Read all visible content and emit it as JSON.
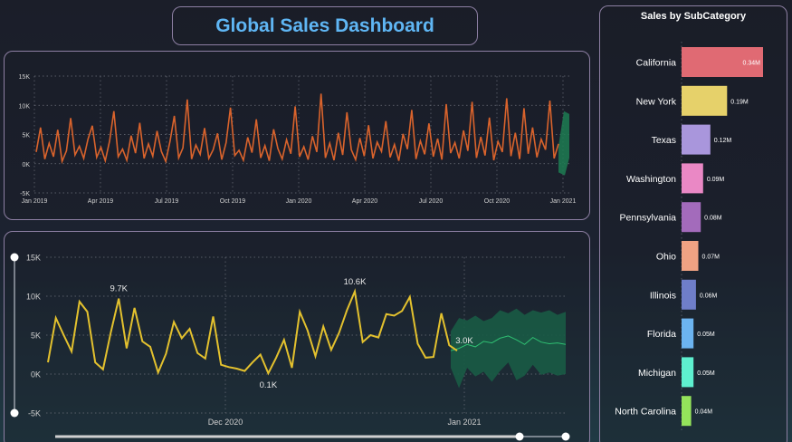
{
  "title": "Global Sales Dashboard",
  "top_chart": {
    "y_ticks": [
      "15K",
      "10K",
      "5K",
      "0K",
      "-5K"
    ],
    "x_ticks": [
      "Jan 2019",
      "Apr 2019",
      "Jul 2019",
      "Oct 2019",
      "Jan 2020",
      "Apr 2020",
      "Jul 2020",
      "Oct 2020",
      "Jan 2021"
    ],
    "colors": {
      "line": "#d9632c",
      "forecast": "#1d7d52"
    }
  },
  "bottom_chart": {
    "y_ticks": [
      "15K",
      "10K",
      "5K",
      "0K",
      "-5K"
    ],
    "x_ticks": [
      "Dec 2020",
      "Jan 2021"
    ],
    "annotations": [
      "9.7K",
      "10.6K",
      "0.1K",
      "3.0K"
    ],
    "colors": {
      "line": "#e3c12e",
      "forecast": "#1a5b45",
      "forecast_line": "#2fbf72"
    }
  },
  "bar_chart": {
    "title": "Sales by SubCategory",
    "categories": [
      "California",
      "New York",
      "Texas",
      "Washington",
      "Pennsylvania",
      "Ohio",
      "Illinois",
      "Florida",
      "Michigan",
      "North Carolina"
    ],
    "values": [
      0.34,
      0.19,
      0.12,
      0.09,
      0.08,
      0.07,
      0.06,
      0.05,
      0.05,
      0.04
    ],
    "labels": [
      "0.34M",
      "0.19M",
      "0.12M",
      "0.09M",
      "0.08M",
      "0.07M",
      "0.06M",
      "0.05M",
      "0.05M",
      "0.04M"
    ],
    "colors": [
      "#e06a73",
      "#e6d16a",
      "#a996dc",
      "#ea88c5",
      "#a36bbb",
      "#f0a283",
      "#6f7ec9",
      "#6cb4f0",
      "#5ef0cf",
      "#94e35b"
    ]
  },
  "chart_data": [
    {
      "type": "line",
      "title": "",
      "xlabel": "",
      "ylabel": "",
      "ylim": [
        -5000,
        15000
      ],
      "x_range": [
        "2019-01-01",
        "2021-01-15"
      ],
      "grid": true,
      "series": [
        {
          "values": [
            2000,
            6200,
            800,
            3500,
            1200,
            5800,
            400,
            2200,
            7800,
            1500,
            3000,
            900,
            4200,
            6500,
            1100,
            2800,
            500,
            3900,
            9000,
            1200,
            2500,
            600,
            4800,
            1800,
            7000,
            900,
            3400,
            1300,
            5600,
            2100,
            400,
            3800,
            8200,
            1000,
            2700,
            11000,
            800,
            3200,
            1600,
            6100,
            900,
            2400,
            5200,
            700,
            3600,
            9600,
            1400,
            2300,
            600,
            4500,
            1900,
            7600,
            1000,
            3100,
            500,
            5900,
            2600,
            800,
            4100,
            1700,
            9800,
            1200,
            2900,
            700,
            4700,
            2000,
            12000,
            1000,
            3500,
            600,
            5300,
            1500,
            8800,
            2400,
            700,
            4400,
            1300,
            6600,
            900,
            3700,
            2100,
            7300,
            1100,
            3300,
            500,
            5100,
            2500,
            9200,
            800,
            3900,
            1600,
            6900,
            1200,
            4300,
            700,
            10200,
            1800,
            3600,
            900,
            5700,
            2200,
            10600,
            1000,
            4600,
            1400,
            7900,
            600,
            3800,
            2000,
            11200,
            1300,
            5300,
            800,
            9500,
            1700,
            6200,
            1100,
            4200,
            2400,
            10800,
            900,
            3400
          ]
        }
      ],
      "forecast": {
        "x_range": [
          "2020-12-25",
          "2021-01-15"
        ],
        "lower": -2000,
        "upper": 9000
      }
    },
    {
      "type": "line",
      "title": "",
      "xlabel": "",
      "ylabel": "",
      "ylim": [
        -5000,
        15000
      ],
      "grid": true,
      "series": [
        {
          "values": [
            1500,
            7200,
            5000,
            2900,
            9300,
            8000,
            1500,
            600,
            5400,
            9700,
            3300,
            8500,
            4200,
            3500,
            200,
            2600,
            6700,
            4600,
            5800,
            2700,
            2000,
            7400,
            1200,
            900,
            700,
            400,
            1500,
            2500,
            100,
            2100,
            4400,
            800,
            8000,
            5600,
            2300,
            6100,
            3100,
            5300,
            8200,
            10600,
            4100,
            5000,
            4700,
            7700,
            7500,
            8100,
            9900,
            3900,
            2100,
            2200,
            7800,
            3700,
            3000
          ]
        }
      ],
      "forecast": {
        "lower": [
          800,
          -1800,
          800,
          -300,
          300,
          -1000,
          400,
          1500,
          -800,
          -200,
          1200,
          -100,
          200,
          -200,
          0
        ],
        "center": [
          3000,
          3300,
          3800,
          3500,
          4200,
          4000,
          4600,
          4900,
          4400,
          3800,
          4700,
          4100,
          3900,
          4000,
          3800
        ],
        "upper": [
          5500,
          7200,
          6900,
          7500,
          6800,
          7200,
          8200,
          7800,
          8400,
          7600,
          8200,
          7900,
          8200,
          7600,
          8000
        ]
      },
      "x_ticks": [
        "Dec 2020",
        "Jan 2021"
      ],
      "annotations": [
        {
          "label": "9.7K"
        },
        {
          "label": "10.6K"
        },
        {
          "label": "0.1K"
        },
        {
          "label": "3.0K"
        }
      ]
    },
    {
      "type": "bar",
      "title": "Sales by SubCategory",
      "categories": [
        "California",
        "New York",
        "Texas",
        "Washington",
        "Pennsylvania",
        "Ohio",
        "Illinois",
        "Florida",
        "Michigan",
        "North Carolina"
      ],
      "values": [
        0.34,
        0.19,
        0.12,
        0.09,
        0.08,
        0.07,
        0.06,
        0.05,
        0.05,
        0.04
      ],
      "unit": "M"
    }
  ]
}
